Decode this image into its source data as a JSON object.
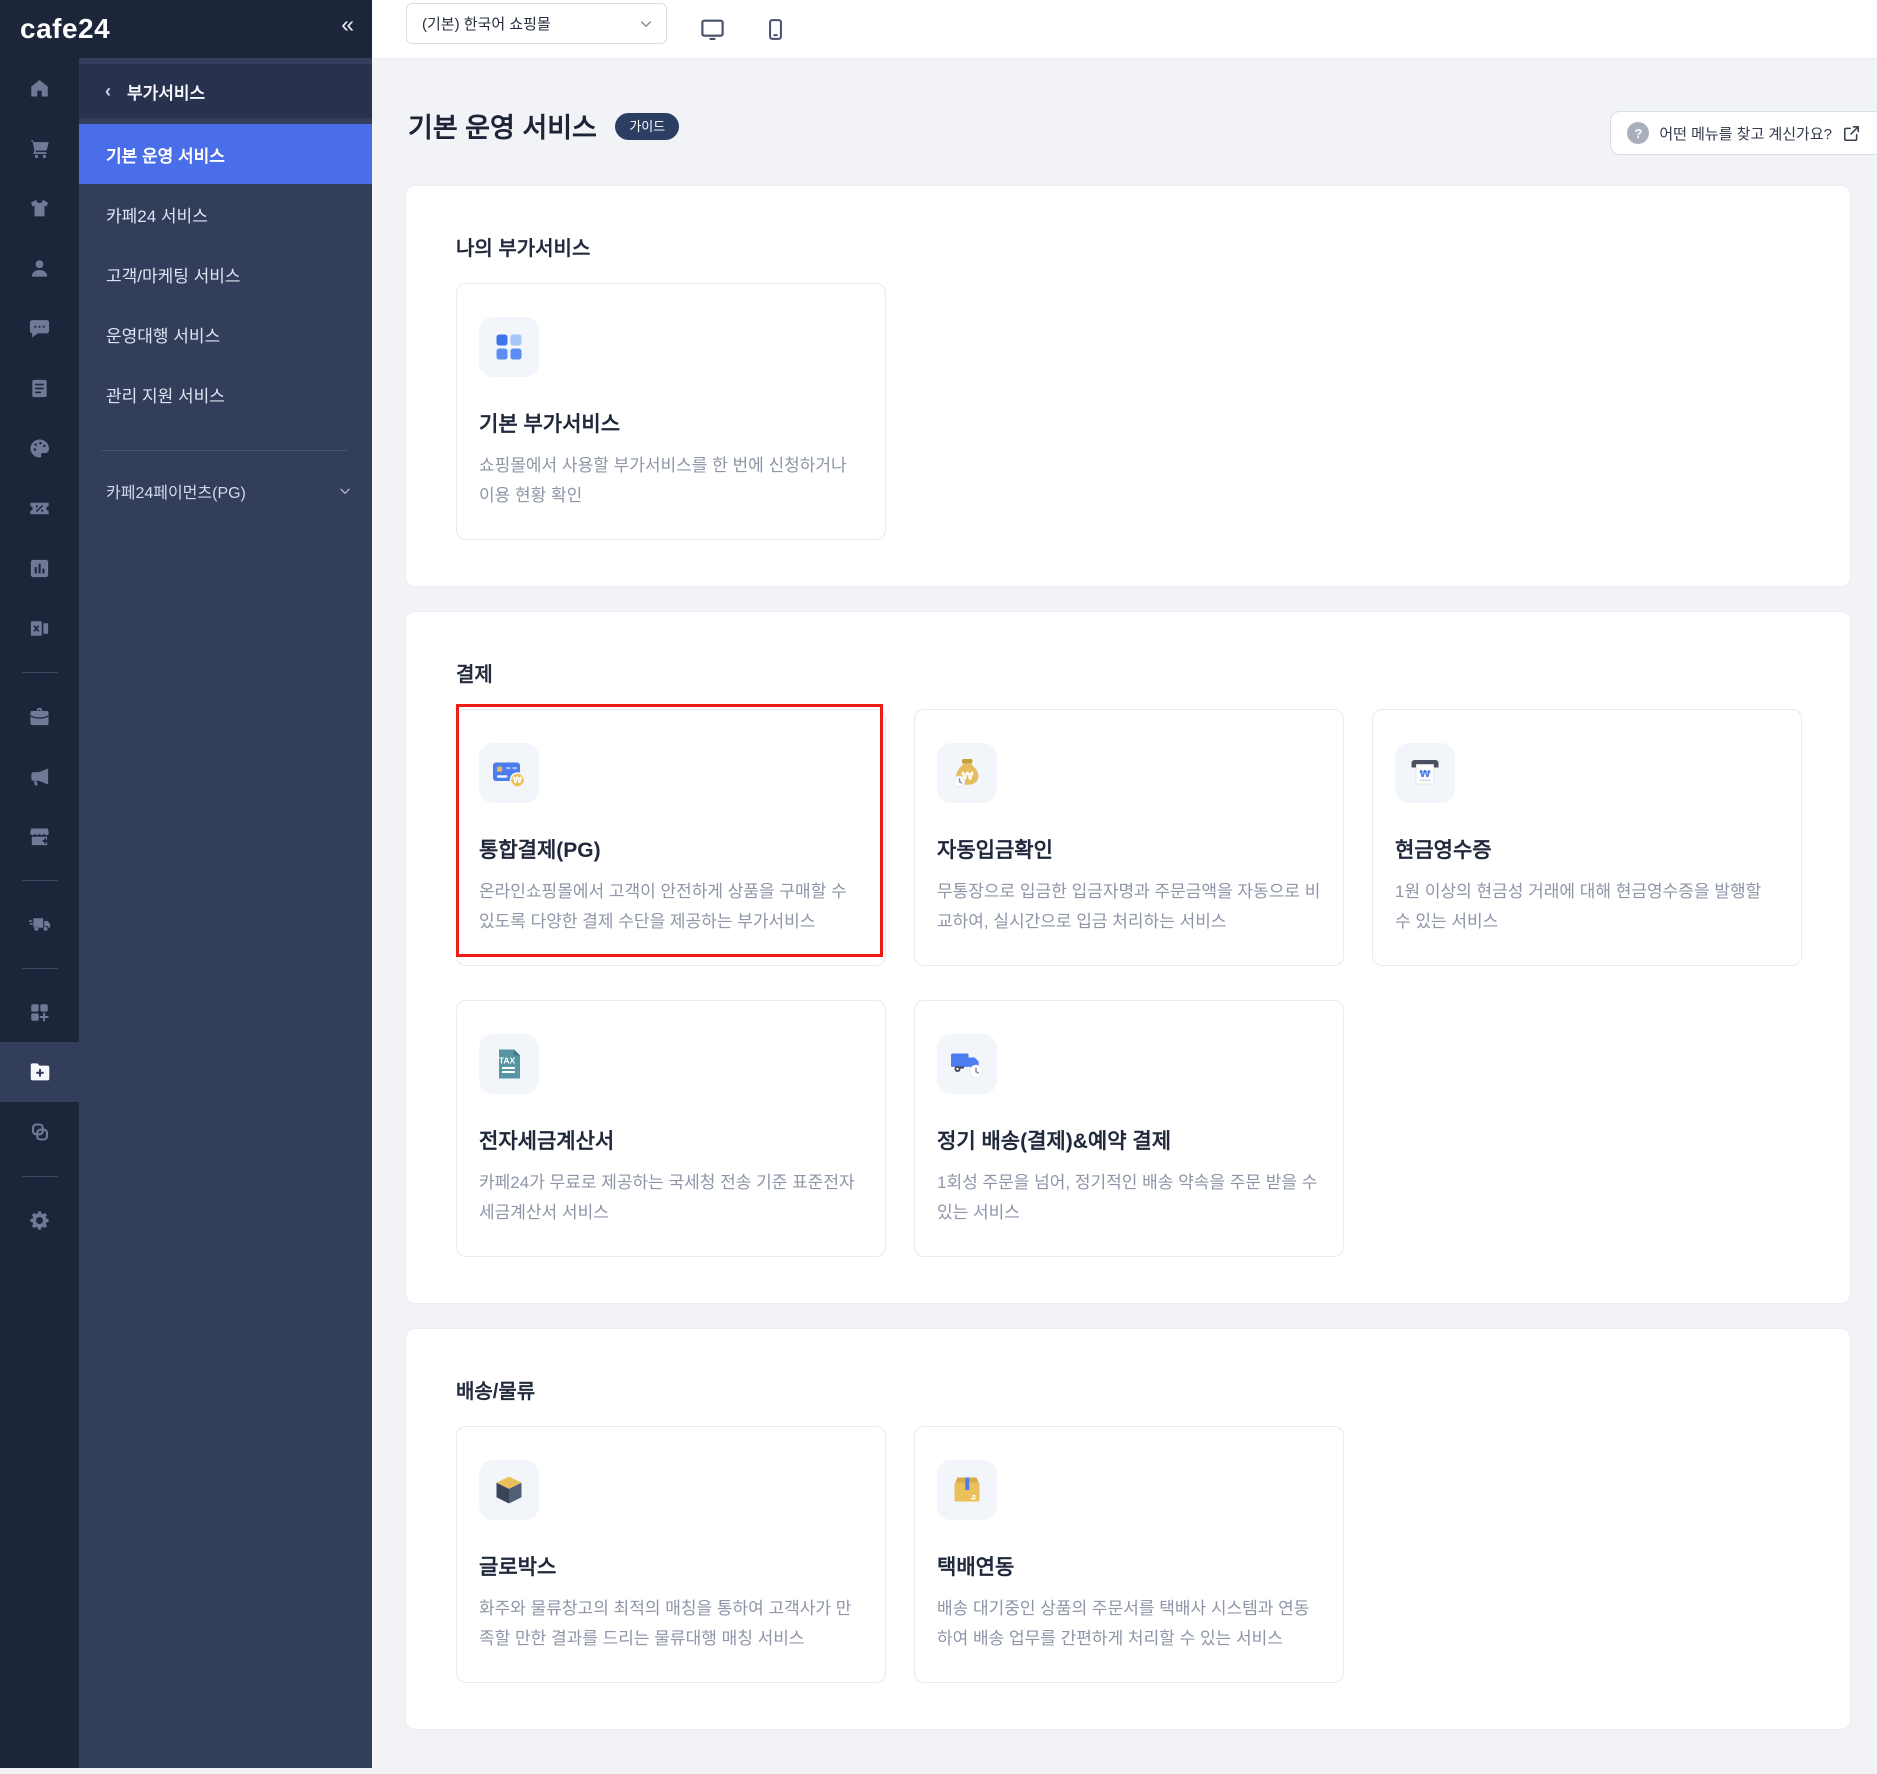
{
  "colors": {
    "accent_blue": "#4a6de9",
    "highlight_red": "#ee1c17",
    "badge_navy": "#2d3e63",
    "sidebar_dark": "#1c2539",
    "sidebar_panel": "#333e5a"
  },
  "brand": {
    "logo_text": "cafe24",
    "collapse_label": "«"
  },
  "topbar": {
    "shop_selector_value": "(기본) 한국어 쇼핑몰",
    "preview_icons": [
      "desktop-preview-icon",
      "mobile-preview-icon"
    ]
  },
  "rail": {
    "items": [
      {
        "icon": "home-icon"
      },
      {
        "icon": "cart-icon"
      },
      {
        "icon": "shirt-icon"
      },
      {
        "icon": "user-icon"
      },
      {
        "icon": "chat-icon"
      },
      {
        "icon": "list-icon"
      },
      {
        "icon": "palette-icon"
      },
      {
        "icon": "coupon-icon"
      },
      {
        "icon": "chart-icon"
      },
      {
        "icon": "excel-icon"
      },
      {
        "divider": true
      },
      {
        "icon": "briefcase-icon"
      },
      {
        "icon": "megaphone-icon"
      },
      {
        "icon": "store-plus-icon"
      },
      {
        "divider": true
      },
      {
        "icon": "truck-icon"
      },
      {
        "divider": true
      },
      {
        "icon": "grid-plus-icon"
      },
      {
        "icon": "folder-plus-icon",
        "active": true
      },
      {
        "icon": "link-icon"
      },
      {
        "divider": true
      },
      {
        "icon": "gear-icon"
      }
    ]
  },
  "sidebar": {
    "back_label": "부가서비스",
    "items": [
      {
        "label": "기본 운영 서비스",
        "active": true
      },
      {
        "label": "카페24 서비스"
      },
      {
        "label": "고객/마케팅 서비스"
      },
      {
        "label": "운영대행 서비스"
      },
      {
        "label": "관리 지원 서비스"
      }
    ],
    "secondary_item": {
      "label": "카페24페이먼츠(PG)"
    }
  },
  "page": {
    "title": "기본 운영 서비스",
    "badge": "가이드",
    "help_button": {
      "label": "어떤 메뉴를 찾고 계신가요?"
    }
  },
  "sections": [
    {
      "heading": "나의 부가서비스",
      "cards": [
        {
          "icon": "apps-grid-icon",
          "title": "기본 부가서비스",
          "description": "쇼핑몰에서 사용할 부가서비스를 한 번에 신청하거나 이용 현황 확인"
        }
      ]
    },
    {
      "heading": "결제",
      "cards": [
        {
          "icon": "pg-card-icon",
          "title": "통합결제(PG)",
          "description": "온라인쇼핑몰에서 고객이 안전하게 상품을 구매할 수 있도록 다양한 결제 수단을 제공하는 부가서비스",
          "highlighted": true
        },
        {
          "icon": "deposit-check-icon",
          "title": "자동입금확인",
          "description": "무통장으로 입금한 입금자명과 주문금액을 자동으로 비교하여, 실시간으로 입금 처리하는 서비스"
        },
        {
          "icon": "cash-receipt-icon",
          "title": "현금영수증",
          "description": "1원 이상의 현금성 거래에 대해 현금영수증을 발행할 수 있는 서비스"
        },
        {
          "icon": "tax-invoice-icon",
          "title": "전자세금계산서",
          "description": "카페24가 무료로 제공하는 국세청 전송 기준 표준전자세금계산서 서비스"
        },
        {
          "icon": "subscription-truck-icon",
          "title": "정기 배송(결제)&예약 결제",
          "description": "1회성 주문을 넘어, 정기적인 배송 약속을 주문 받을 수 있는 서비스"
        }
      ]
    },
    {
      "heading": "배송/물류",
      "cards": [
        {
          "icon": "globox-cube-icon",
          "title": "글로박스",
          "description": "화주와 물류창고의 최적의 매칭을 통하여 고객사가 만족할 만한 결과를 드리는 물류대행 매칭 서비스"
        },
        {
          "icon": "parcel-box-icon",
          "title": "택배연동",
          "description": "배송 대기중인 상품의 주문서를 택배사 시스템과 연동하여 배송 업무를 간편하게 처리할 수 있는 서비스"
        }
      ]
    }
  ]
}
